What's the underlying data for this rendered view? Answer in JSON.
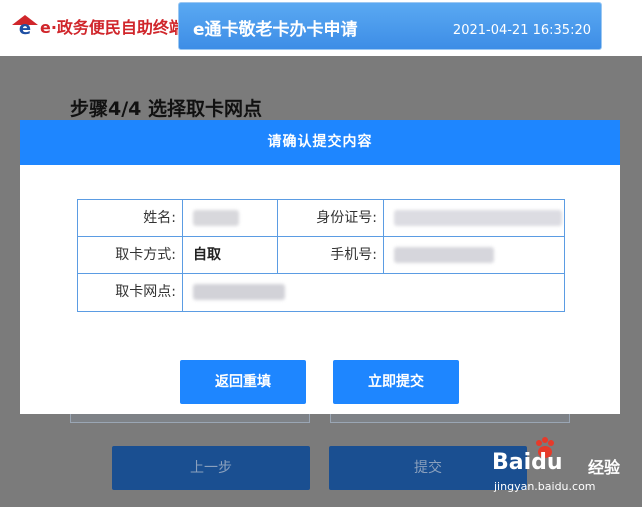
{
  "header": {
    "logo_text": "e·政务便民自助终端",
    "title": "e通卡敬老卡办卡申请",
    "datetime": "2021-04-21 16:35:20"
  },
  "page": {
    "step_title": "步骤4/4 选择取卡网点",
    "prev_button": "上一步",
    "submit_button": "提交"
  },
  "dialog": {
    "title": "请确认提交内容",
    "fields": {
      "name_label": "姓名:",
      "id_label": "身份证号:",
      "method_label": "取卡方式:",
      "method_value": "自取",
      "phone_label": "手机号:",
      "branch_label": "取卡网点:"
    },
    "back_button": "返回重填",
    "submit_button": "立即提交"
  },
  "watermark": {
    "brand": "Baidu",
    "cn": "经验",
    "url": "jingyan.baidu.com"
  }
}
